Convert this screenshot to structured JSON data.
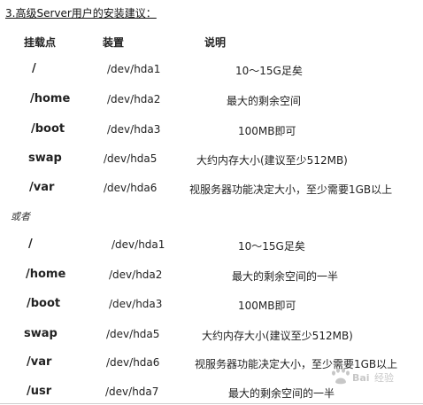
{
  "heading": "3.高级Server用户的安装建议：",
  "columns": {
    "mount": "挂载点",
    "device": "装置",
    "desc": "说明"
  },
  "table1": [
    {
      "mount": "/",
      "device": "/dev/hda1",
      "desc": "10～15G足矣"
    },
    {
      "mount": "/home",
      "device": "/dev/hda2",
      "desc": "最大的剩余空间"
    },
    {
      "mount": "/boot",
      "device": "/dev/hda3",
      "desc": "100MB即可"
    },
    {
      "mount": "swap",
      "device": "/dev/hda5",
      "desc": "大约内存大小(建议至少512MB)"
    },
    {
      "mount": "/var",
      "device": "/dev/hda6",
      "desc": "视服务器功能决定大小，至少需要1GB以上"
    }
  ],
  "or_label": "或者",
  "table2": [
    {
      "mount": "/",
      "device": "/dev/hda1",
      "desc": "10～15G足矣"
    },
    {
      "mount": "/home",
      "device": "/dev/hda2",
      "desc": "最大的剩余空间的一半"
    },
    {
      "mount": "/boot",
      "device": "/dev/hda3",
      "desc": "100MB即可"
    },
    {
      "mount": "swap",
      "device": "/dev/hda5",
      "desc": "大约内存大小(建议至少512MB)"
    },
    {
      "mount": "/var",
      "device": "/dev/hda6",
      "desc": "视服务器功能决定大小，至少需要1GB以上"
    },
    {
      "mount": "/usr",
      "device": "/dev/hda7",
      "desc": "最大的剩余空间的一半"
    }
  ],
  "watermark_text": "Bai 经验",
  "colors": {
    "text": "#222222",
    "background": "#ffffff",
    "watermark": "#9a9a9a"
  }
}
